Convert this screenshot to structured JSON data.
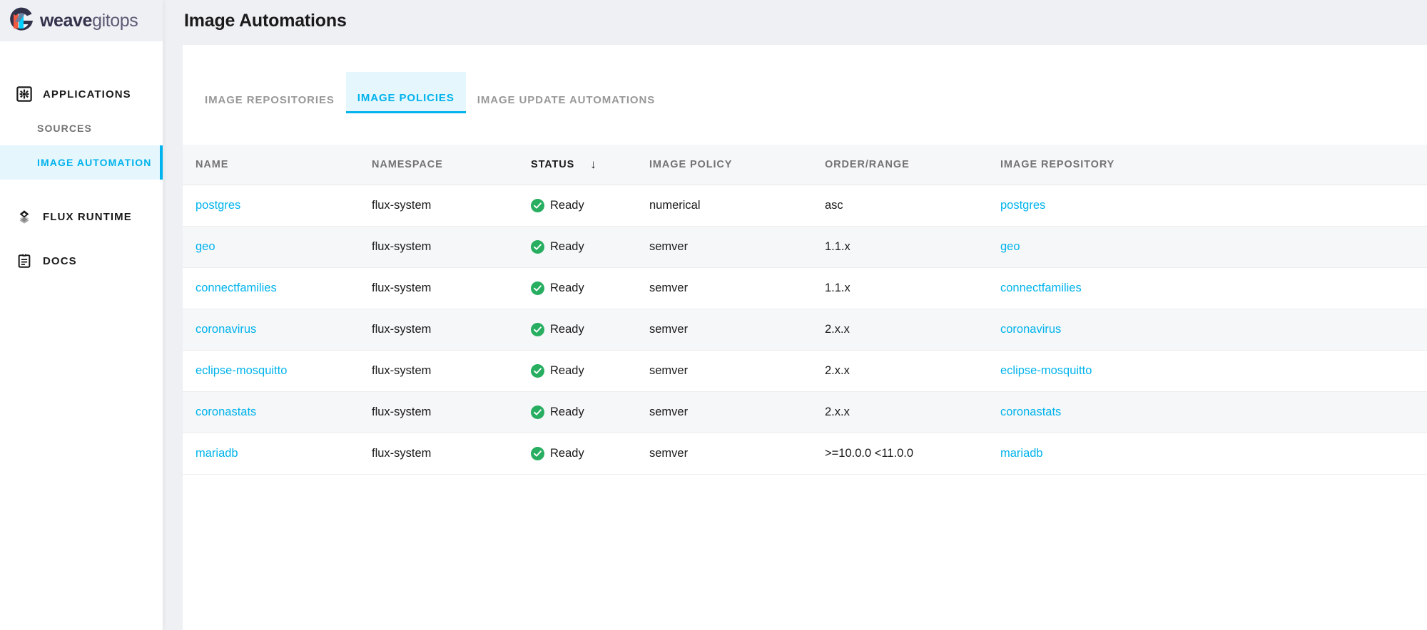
{
  "brand": {
    "name_bold": "weave",
    "name_light": "gitops",
    "logo_icon": "weave-gitops-logo-icon",
    "accent_color": "#00b3ec",
    "status_ok_color": "#27AE60"
  },
  "sidebar": {
    "items": [
      {
        "label": "APPLICATIONS",
        "icon": "applications-gear-square-icon",
        "level": "top",
        "active": false
      },
      {
        "label": "SOURCES",
        "icon": "",
        "level": "sub",
        "active": false
      },
      {
        "label": "IMAGE AUTOMATION",
        "icon": "",
        "level": "sub",
        "active": true
      },
      {
        "label": "FLUX RUNTIME",
        "icon": "flux-diamond-icon",
        "level": "top",
        "active": false
      },
      {
        "label": "DOCS",
        "icon": "docs-clipboard-icon",
        "level": "top",
        "active": false
      }
    ]
  },
  "header": {
    "title": "Image Automations"
  },
  "tabs": [
    {
      "label": "IMAGE REPOSITORIES",
      "active": false
    },
    {
      "label": "IMAGE POLICIES",
      "active": true
    },
    {
      "label": "IMAGE UPDATE AUTOMATIONS",
      "active": false
    }
  ],
  "table": {
    "sort_column": "STATUS",
    "sort_direction_icon": "↓",
    "columns": [
      {
        "label": "NAME",
        "sorted": false
      },
      {
        "label": "NAMESPACE",
        "sorted": false
      },
      {
        "label": "STATUS",
        "sorted": true
      },
      {
        "label": "IMAGE POLICY",
        "sorted": false
      },
      {
        "label": "ORDER/RANGE",
        "sorted": false
      },
      {
        "label": "IMAGE REPOSITORY",
        "sorted": false
      }
    ],
    "rows": [
      {
        "name": "postgres",
        "namespace": "flux-system",
        "status": "Ready",
        "status_icon": "check-circle-icon",
        "policy": "numerical",
        "order": "asc",
        "repository": "postgres"
      },
      {
        "name": "geo",
        "namespace": "flux-system",
        "status": "Ready",
        "status_icon": "check-circle-icon",
        "policy": "semver",
        "order": "1.1.x",
        "repository": "geo"
      },
      {
        "name": "connectfamilies",
        "namespace": "flux-system",
        "status": "Ready",
        "status_icon": "check-circle-icon",
        "policy": "semver",
        "order": "1.1.x",
        "repository": "connectfamilies"
      },
      {
        "name": "coronavirus",
        "namespace": "flux-system",
        "status": "Ready",
        "status_icon": "check-circle-icon",
        "policy": "semver",
        "order": "2.x.x",
        "repository": "coronavirus"
      },
      {
        "name": "eclipse-mosquitto",
        "namespace": "flux-system",
        "status": "Ready",
        "status_icon": "check-circle-icon",
        "policy": "semver",
        "order": "2.x.x",
        "repository": "eclipse-mosquitto"
      },
      {
        "name": "coronastats",
        "namespace": "flux-system",
        "status": "Ready",
        "status_icon": "check-circle-icon",
        "policy": "semver",
        "order": "2.x.x",
        "repository": "coronastats"
      },
      {
        "name": "mariadb",
        "namespace": "flux-system",
        "status": "Ready",
        "status_icon": "check-circle-icon",
        "policy": "semver",
        "order": ">=10.0.0 <11.0.0",
        "repository": "mariadb"
      }
    ]
  }
}
